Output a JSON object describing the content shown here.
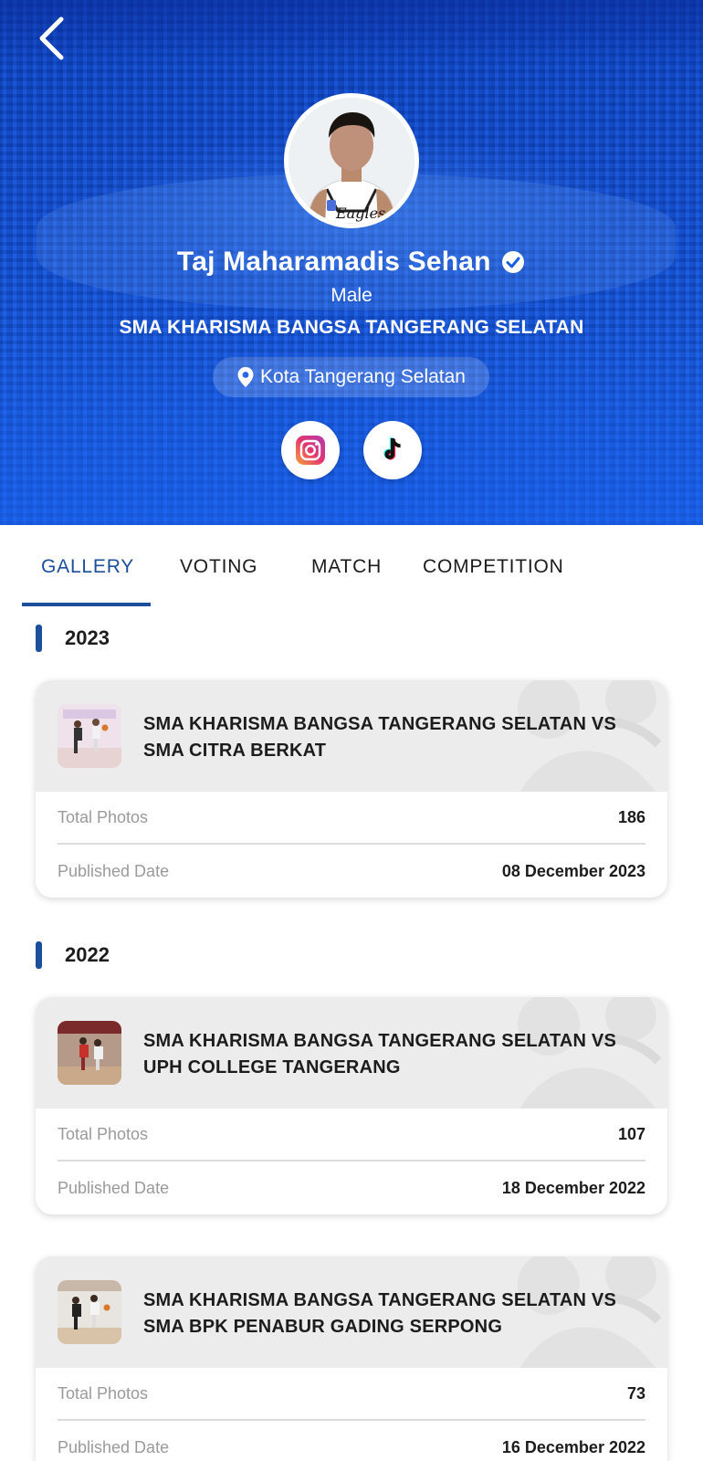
{
  "profile": {
    "name": "Taj Maharamadis Sehan",
    "gender": "Male",
    "school": "SMA KHARISMA BANGSA TANGERANG SELATAN",
    "location": "Kota Tangerang Selatan",
    "verified": true
  },
  "social": {
    "instagram_icon": "instagram-icon",
    "tiktok_icon": "tiktok-icon"
  },
  "tabs": [
    "GALLERY",
    "VOTING",
    "MATCH",
    "COMPETITION"
  ],
  "active_tab": "GALLERY",
  "sections": [
    {
      "year": "2023",
      "items": [
        {
          "title": "SMA KHARISMA BANGSA TANGERANG SELATAN VS SMA CITRA BERKAT",
          "total_photos_label": "Total Photos",
          "total_photos": "186",
          "published_label": "Published Date",
          "published_date": "08 December 2023"
        }
      ]
    },
    {
      "year": "2022",
      "items": [
        {
          "title": "SMA KHARISMA BANGSA TANGERANG SELATAN VS UPH COLLEGE TANGERANG",
          "total_photos_label": "Total Photos",
          "total_photos": "107",
          "published_label": "Published Date",
          "published_date": "18 December 2022"
        },
        {
          "title": "SMA KHARISMA BANGSA TANGERANG SELATAN VS SMA BPK PENABUR GADING SERPONG",
          "total_photos_label": "Total Photos",
          "total_photos": "73",
          "published_label": "Published Date",
          "published_date": "16 December 2022"
        }
      ]
    }
  ],
  "colors": {
    "accent": "#1b4f9c",
    "hero": "#1a5ee4",
    "card_header": "#ececec"
  }
}
